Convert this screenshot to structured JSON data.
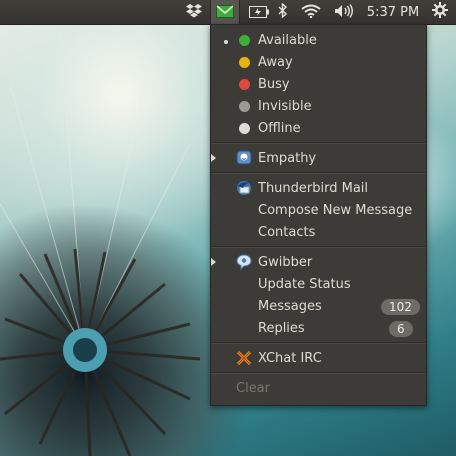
{
  "panel": {
    "clock": "5:37 PM",
    "indicators": [
      "dropbox-icon",
      "mail-icon",
      "battery-icon",
      "bluetooth-icon",
      "wifi-icon",
      "volume-icon",
      "gear-icon"
    ],
    "mail_active_color": "#3dae3a"
  },
  "status": [
    {
      "label": "Available",
      "color": "#3eae3b",
      "selected": true
    },
    {
      "label": "Away",
      "color": "#e8b20f",
      "selected": false
    },
    {
      "label": "Busy",
      "color": "#e04840",
      "selected": false
    },
    {
      "label": "Invisible",
      "color": "#9b9a95",
      "selected": false
    },
    {
      "label": "Offline",
      "color": "#dedcd6",
      "selected": false
    }
  ],
  "empathy": {
    "label": "Empathy"
  },
  "thunderbird": {
    "label": "Thunderbird Mail",
    "compose": "Compose New Message",
    "contacts": "Contacts"
  },
  "gwibber": {
    "label": "Gwibber",
    "update_status": "Update Status",
    "messages": "Messages",
    "messages_count": "102",
    "replies": "Replies",
    "replies_count": "6"
  },
  "xchat": {
    "label": "XChat IRC"
  },
  "clear": {
    "label": "Clear"
  }
}
